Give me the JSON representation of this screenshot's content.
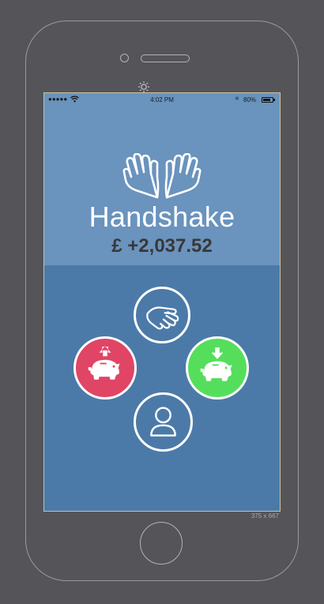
{
  "device": {
    "size_label": "375 x 667"
  },
  "status_bar": {
    "signal": "●●●●●",
    "time": "4:02 PM",
    "battery": "80%"
  },
  "header": {
    "title": "Handshake",
    "balance": "£ +2,037.52"
  },
  "actions": {
    "handshake_icon": "handshake-icon",
    "withdraw_icon": "piggy-bank-up-icon",
    "deposit_icon": "piggy-bank-down-icon",
    "profile_icon": "user-icon"
  },
  "colors": {
    "screen_bg": "#4c7aa8",
    "header_bg": "#6a93bd",
    "withdraw": "#e04566",
    "deposit": "#55de5c",
    "balance_text": "#383838"
  }
}
